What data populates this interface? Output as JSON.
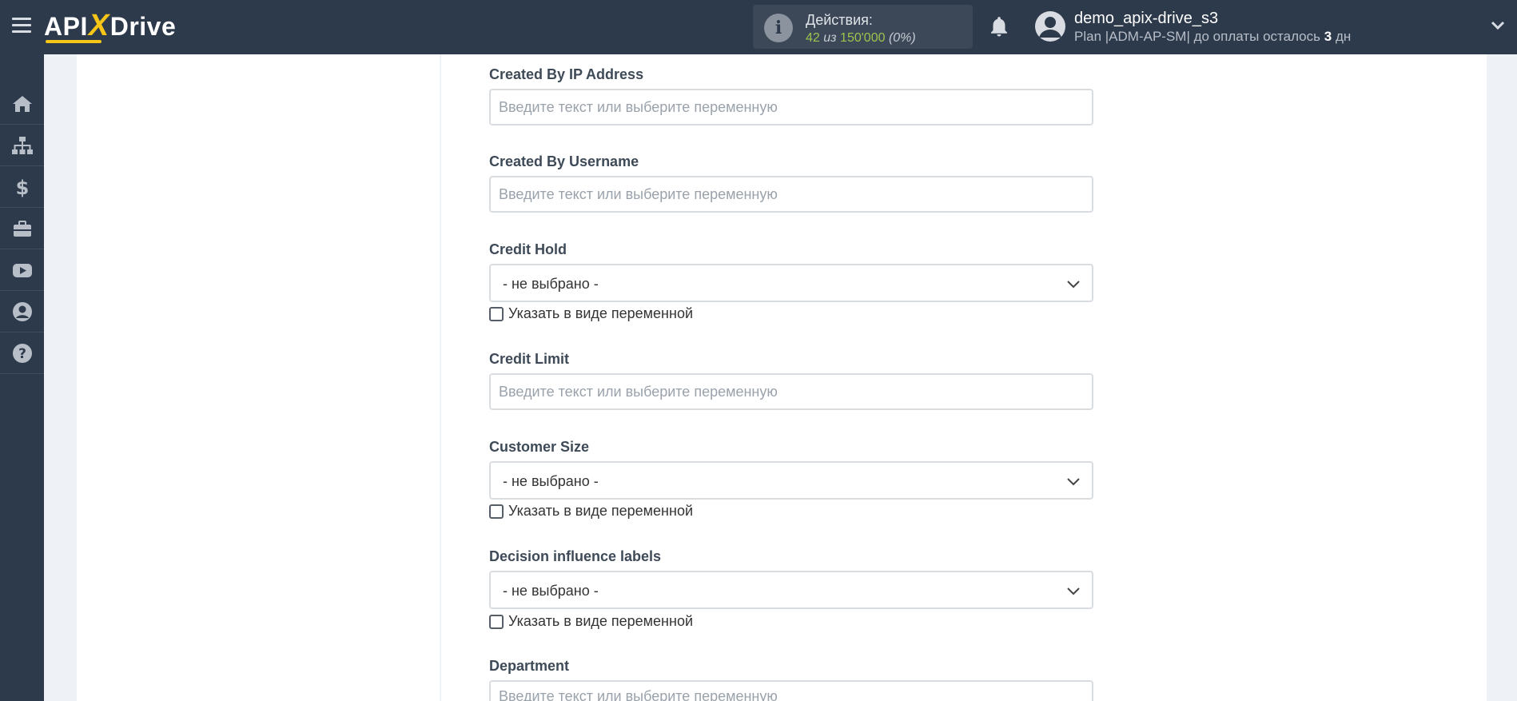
{
  "header": {
    "logo": {
      "api": "API",
      "x": "X",
      "drive": "Drive"
    },
    "actions": {
      "title": "Действия:",
      "used": "42",
      "separator": "из",
      "total": "150'000",
      "percent": "(0%)"
    },
    "user": {
      "name": "demo_apix-drive_s3",
      "plan_prefix": "Plan |ADM-AP-SM| до оплаты осталось",
      "days_value": "3",
      "days_unit": "дн"
    }
  },
  "sidebar": {
    "items": [
      {
        "icon": "home-icon"
      },
      {
        "icon": "sitemap-icon"
      },
      {
        "icon": "dollar-icon"
      },
      {
        "icon": "briefcase-icon"
      },
      {
        "icon": "youtube-icon"
      },
      {
        "icon": "user-circle-icon"
      },
      {
        "icon": "question-icon"
      }
    ]
  },
  "form": {
    "placeholder": "Введите текст или выберите переменную",
    "select_default": "- не выбрано -",
    "variable_checkbox_label": "Указать в виде переменной",
    "fields": {
      "created_by_ip": {
        "label": "Created By IP Address"
      },
      "created_by_username": {
        "label": "Created By Username"
      },
      "credit_hold": {
        "label": "Credit Hold"
      },
      "credit_limit": {
        "label": "Credit Limit"
      },
      "customer_size": {
        "label": "Customer Size"
      },
      "decision_influence": {
        "label": "Decision influence labels"
      },
      "department": {
        "label": "Department"
      }
    }
  },
  "colors": {
    "topbar": "#2d3a4b",
    "accent": "#f5c518",
    "counter_green": "#9dc34f"
  }
}
